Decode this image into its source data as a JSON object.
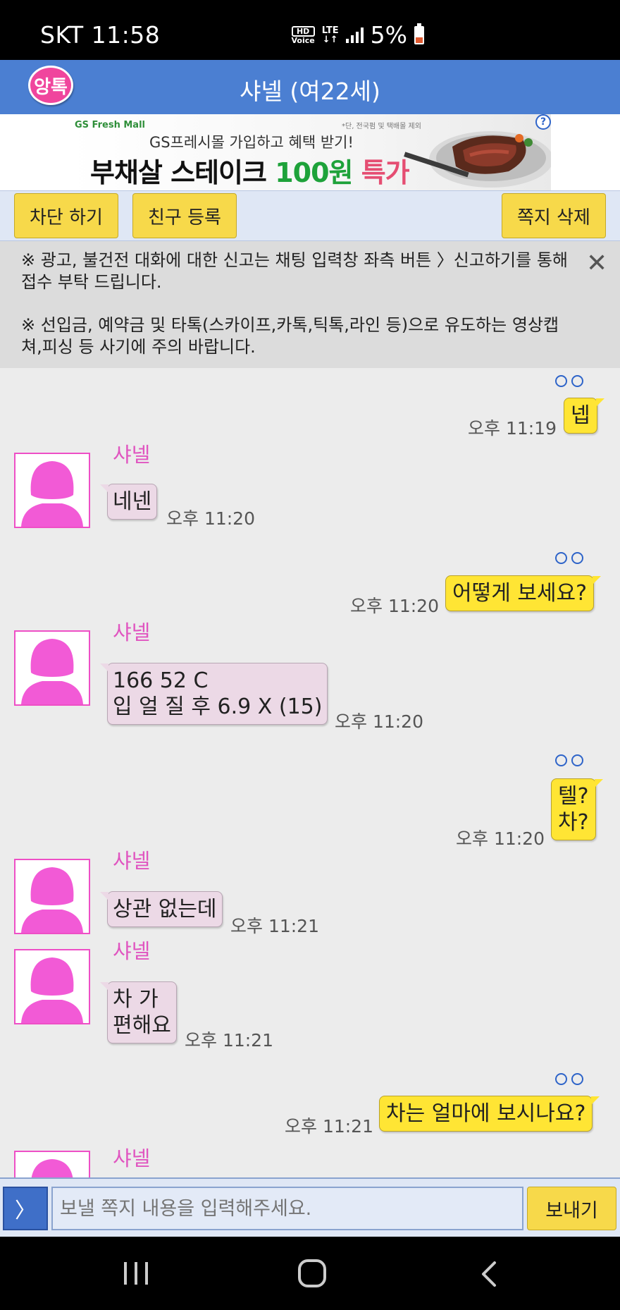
{
  "status_bar": {
    "carrier_time": "SKT 11:58",
    "hd": "HD",
    "voice": "Voice",
    "lte": "LTE",
    "battery": "5%"
  },
  "header": {
    "logo_text": "앙톡",
    "title": "샤넬 (여22세)"
  },
  "ad": {
    "brand": "GS Fresh Mall",
    "note": "*단, 전국펌 및 택배몰 제외",
    "subtitle": "GS프레시몰 가입하고 혜택 받기!",
    "headline_1": "부채살 스테이크 ",
    "headline_2": "100원",
    "headline_3": " 특가",
    "help": "?"
  },
  "actions": {
    "block": "차단 하기",
    "add_friend": "친구 등록",
    "delete": "쪽지 삭제"
  },
  "notice": {
    "line1": "※ 광고, 불건전 대화에 대한 신고는 채팅 입력창 좌측 버튼 〉신고하기를 통해 접수 부탁 드립니다.",
    "line2": "※ 선입금, 예약금 및 타톡(스카이프,카톡,틱톡,라인 등)으로 유도하는 영상캡쳐,피싱 등 사기에 주의 바랍니다.",
    "close": "✕"
  },
  "messages": [
    {
      "dir": "out",
      "text": "넵",
      "time": "오후 11:19"
    },
    {
      "dir": "in",
      "sender": "샤넬",
      "text": "네넨",
      "time": "오후 11:20"
    },
    {
      "dir": "out",
      "text": "어떻게 보세요?",
      "time": "오후 11:20"
    },
    {
      "dir": "in",
      "sender": "샤넬",
      "text_line1": "166 52 C",
      "text_line2": "입 얼 질 후  6.9 X (15)",
      "time": "오후 11:20"
    },
    {
      "dir": "out",
      "text_line1": "텔?",
      "text_line2": "차?",
      "time": "오후 11:20"
    },
    {
      "dir": "in",
      "sender": "샤넬",
      "text": "상관 없는데",
      "time": "오후 11:21"
    },
    {
      "dir": "in",
      "sender": "샤넬",
      "text_line1": "차 가",
      "text_line2": "편해요",
      "time": "오후 11:21"
    },
    {
      "dir": "out",
      "text": "차는 얼마에 보시나요?",
      "time": "오후 11:21"
    },
    {
      "dir": "in",
      "sender": "샤넬"
    }
  ],
  "input": {
    "toggle": "〉",
    "placeholder": "보낼 쪽지 내용을 입력해주세요.",
    "send": "보내기"
  },
  "colors": {
    "header_blue": "#4b7fd2",
    "button_yellow": "#f7d94a",
    "outgoing_bubble": "#ffe534",
    "incoming_bubble": "#ecd9e6",
    "sender_pink": "#e055c0",
    "read_dot_blue": "#2e64c9"
  }
}
